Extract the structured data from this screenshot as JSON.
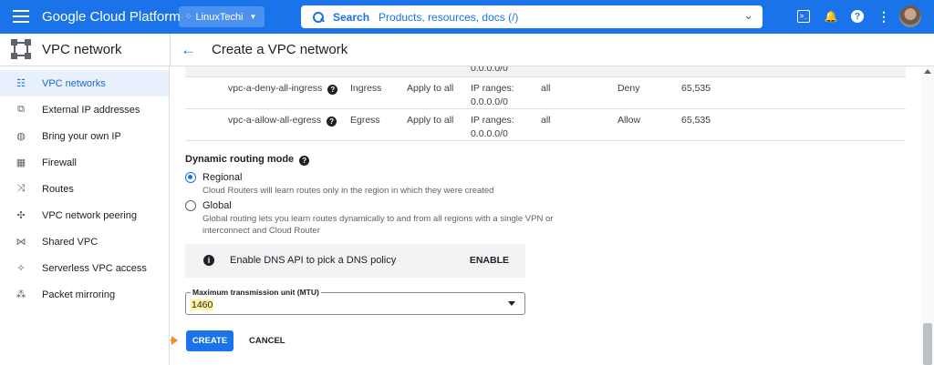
{
  "topbar": {
    "brand": "Google Cloud Platform",
    "project": "LinuxTechi",
    "search_label": "Search",
    "search_placeholder": "Products, resources, docs (/)"
  },
  "header": {
    "product": "VPC network",
    "page_title": "Create a VPC network"
  },
  "sidebar": {
    "items": [
      {
        "label": "VPC networks",
        "icon": "vpc-networks-icon",
        "active": true
      },
      {
        "label": "External IP addresses",
        "icon": "external-ip-icon",
        "active": false
      },
      {
        "label": "Bring your own IP",
        "icon": "globe-icon",
        "active": false
      },
      {
        "label": "Firewall",
        "icon": "firewall-icon",
        "active": false
      },
      {
        "label": "Routes",
        "icon": "routes-icon",
        "active": false
      },
      {
        "label": "VPC network peering",
        "icon": "peering-icon",
        "active": false
      },
      {
        "label": "Shared VPC",
        "icon": "shared-vpc-icon",
        "active": false
      },
      {
        "label": "Serverless VPC access",
        "icon": "serverless-icon",
        "active": false
      },
      {
        "label": "Packet mirroring",
        "icon": "packet-mirroring-icon",
        "active": false
      }
    ]
  },
  "firewall_rules": {
    "partial_row_text": "0.0.0.0/0",
    "rows": [
      {
        "name": "vpc-a-deny-all-ingress",
        "direction": "Ingress",
        "applies": "Apply to all",
        "filter_label": "IP ranges:",
        "filter_value": "0.0.0.0/0",
        "protocols": "all",
        "action": "Deny",
        "priority": "65,535"
      },
      {
        "name": "vpc-a-allow-all-egress",
        "direction": "Egress",
        "applies": "Apply to all",
        "filter_label": "IP ranges:",
        "filter_value": "0.0.0.0/0",
        "protocols": "all",
        "action": "Allow",
        "priority": "65,535"
      }
    ]
  },
  "routing": {
    "title": "Dynamic routing mode",
    "regional_label": "Regional",
    "regional_desc": "Cloud Routers will learn routes only in the region in which they were created",
    "global_label": "Global",
    "global_desc_1": "Global routing lets you learn routes dynamically to and from all regions with a single VPN or",
    "global_desc_2": "interconnect and Cloud Router",
    "selected": "Regional"
  },
  "dns": {
    "text": "Enable DNS API to pick a DNS policy",
    "action": "ENABLE"
  },
  "mtu": {
    "label": "Maximum transmission unit (MTU)",
    "value": "1460"
  },
  "actions": {
    "create": "CREATE",
    "cancel": "CANCEL"
  },
  "colors": {
    "brand_blue": "#1a73e8",
    "highlight": "#fff59d",
    "annotation_arrow": "#f28b30"
  }
}
